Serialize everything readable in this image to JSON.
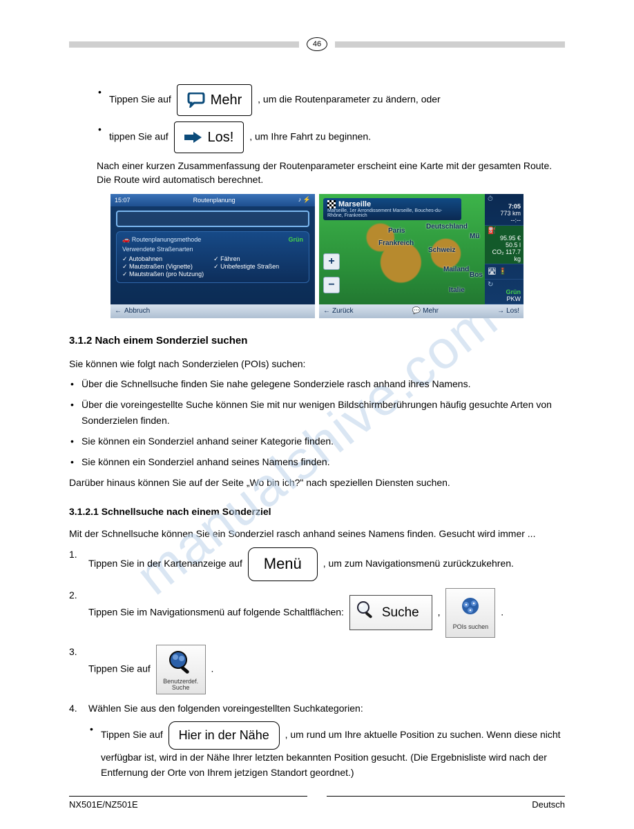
{
  "header": {
    "page_number": "46"
  },
  "watermark": "manualshive.com",
  "intro": {
    "bullet1_a": "Tippen Sie auf",
    "bullet1_b": ", um die Routenparameter zu ändern, oder",
    "bullet2_a": "tippen Sie auf",
    "bullet2_b": ", um Ihre Fahrt zu beginnen."
  },
  "btn_mehr": "Mehr",
  "btn_los": "Los!",
  "btn_menu": "Menü",
  "btn_suche": "Suche",
  "tile_pois": "POIs suchen",
  "tile_benutz": "Benutzerdef. Suche",
  "btn_hier": "Hier in der Nähe",
  "after_shots": "Nach einer kurzen Zusammenfassung der Routenparameter erscheint eine Karte mit der gesamten Route. Die Route wird automatisch berechnet.",
  "shot_left": {
    "time": "15:07",
    "title": "Routenplanung",
    "method_label": "Routenplanungsmethode",
    "method_value": "Grün",
    "roads_label": "Verwendete Straßenarten",
    "roads_col1": [
      "Autobahnen",
      "Mautstraßen (Vignette)",
      "Mautstraßen (pro Nutzung)"
    ],
    "roads_col2": [
      "Fähren",
      "Unbefestigte Straßen"
    ],
    "abort": "Abbruch"
  },
  "shot_right": {
    "city": "Marseille",
    "city_sub": "Marseille, 1er Arrondissement Marseille, Bouches-du-Rhône, Frankreich",
    "labels": {
      "paris": "Paris",
      "frankreich": "Frankreich",
      "deutschland": "Deutschland",
      "mu": "Mü",
      "schweiz": "Schweiz",
      "mailand": "Mailand",
      "bos": "Bos",
      "italie": "Italie"
    },
    "side": {
      "time": "7:05",
      "dist": "773 km",
      "dash": "--:--",
      "cost": "95.95 €",
      "fuel": "50.5 l",
      "co2": "117.7 kg",
      "mode": "Grün",
      "vehicle": "PKW"
    },
    "bottom": {
      "back": "Zurück",
      "more": "Mehr",
      "go": "Los!"
    }
  },
  "sec_title": "3.1.2 Nach einem Sonderziel suchen",
  "sec_intro": "Sie können wie folgt nach Sonderzielen (POIs) suchen:",
  "sec_items": [
    "Über die Schnellsuche finden Sie nahe gelegene Sonderziele rasch anhand ihres Namens.",
    "Über die voreingestellte Suche können Sie mit nur wenigen Bildschirmberührungen häufig gesuchte Arten von Sonderzielen finden.",
    "Sie können ein Sonderziel anhand seiner Kategorie finden.",
    "Sie können ein Sonderziel anhand seines Namens finden."
  ],
  "extra": "Darüber hinaus können Sie auf der Seite „Wo bin ich?\" nach speziellen Diensten suchen.",
  "sub_title": "3.1.2.1 Schnellsuche nach einem Sonderziel",
  "sub_intro": "Mit der Schnellsuche können Sie ein Sonderziel rasch anhand seines Namens finden. Gesucht wird immer ...",
  "step1_a": "Tippen Sie in der Kartenanzeige auf",
  "step1_b": ", um zum Navigationsmenü zurückzukehren.",
  "step2_a": "Tippen Sie im Navigationsmenü auf folgende Schaltflächen:",
  "step2_b": ",",
  "step2_c": ".",
  "step3": "Tippen Sie auf",
  "step3_b": ".",
  "step4": "Wählen Sie aus den folgenden voreingestellten Suchkategorien:",
  "opt4_a": "Tippen Sie auf",
  "opt4_b": ", um rund um Ihre aktuelle Position zu suchen. Wenn diese nicht verfügbar ist, wird in der Nähe Ihrer letzten bekannten Position gesucht. (Die Ergebnisliste wird nach der Entfernung der Orte von Ihrem jetzigen Standort geordnet.)",
  "footer": {
    "left": "NX501E/NZ501E",
    "right": "Deutsch"
  }
}
